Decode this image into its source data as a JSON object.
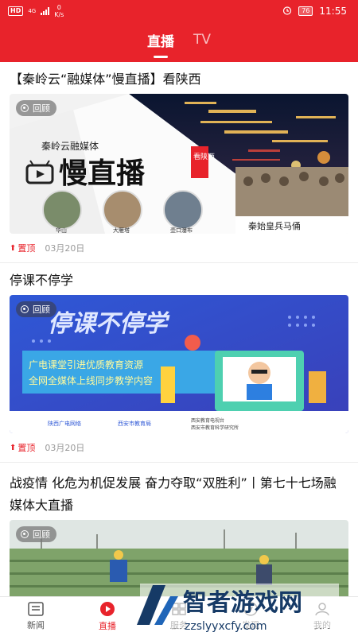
{
  "status_bar": {
    "hd": "HD",
    "network": "4G",
    "speed_value": "0",
    "speed_unit": "K/s",
    "battery": "76",
    "time": "11:55"
  },
  "top_tabs": [
    {
      "label": "直播",
      "active": true
    },
    {
      "label": "TV",
      "active": false
    }
  ],
  "feed": [
    {
      "title": "【秦岭云“融媒体”慢直播】看陕西",
      "badge": "回顾",
      "pin": "置顶",
      "date": "03月20日",
      "image": {
        "brand": "秦岭云融媒体",
        "headline": "慢直播",
        "stamp": "看陕西",
        "spots": [
          "华山",
          "大雁塔",
          "壶口瀑布"
        ],
        "feature": "秦始皇兵马俑"
      }
    },
    {
      "title": "停课不停学",
      "badge": "回顾",
      "pin": "置顶",
      "date": "03月20日",
      "image": {
        "headline": "停课不停学",
        "line1": "广电课堂引进优质教育资源",
        "line2": "全网全媒体上线同步教学内容",
        "footer_left": "陕西广电网络",
        "footer_mid": "西安市教育局",
        "footer_right1": "西安教育电视台",
        "footer_right2": "西安市教育科学研究所"
      }
    },
    {
      "title": "战疫情 化危为机促发展 奋力夺取“双胜利”丨第七十七场融媒体大直播",
      "badge": "回顾"
    }
  ],
  "bottom_nav": [
    {
      "label": "新闻",
      "icon": "news-icon",
      "active": false
    },
    {
      "label": "直播",
      "icon": "live-icon",
      "active": true
    },
    {
      "label": "服务",
      "icon": "service-icon",
      "active": false
    },
    {
      "label": "发现",
      "icon": "discover-icon",
      "active": false
    },
    {
      "label": "我的",
      "icon": "profile-icon",
      "active": false
    }
  ],
  "watermark": {
    "name": "智者游戏网",
    "url": "zzslyyxcfy.com"
  },
  "colors": {
    "brand_red": "#e8232b"
  }
}
